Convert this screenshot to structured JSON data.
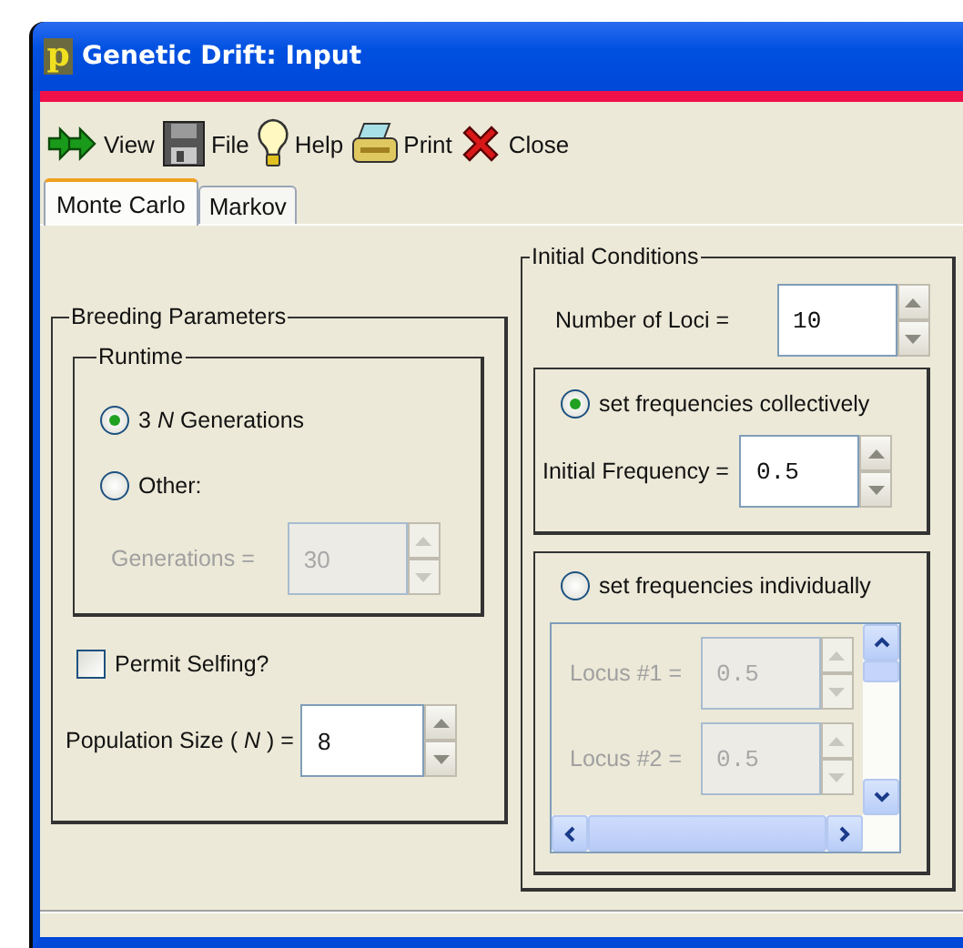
{
  "window": {
    "title": "Genetic Drift: Input",
    "icon_letter": "p"
  },
  "toolbar": [
    {
      "kind": "view",
      "label": "View"
    },
    {
      "kind": "file",
      "label": "File"
    },
    {
      "kind": "help",
      "label": "Help"
    },
    {
      "kind": "print",
      "label": "Print"
    },
    {
      "kind": "close",
      "label": "Close"
    }
  ],
  "tabs": [
    {
      "label": "Monte Carlo",
      "selected": true
    },
    {
      "label": "Markov",
      "selected": false
    }
  ],
  "breeding": {
    "title": "Breeding Parameters",
    "runtime": {
      "title": "Runtime",
      "options": [
        {
          "label": "3 *N* Generations",
          "selected": true
        },
        {
          "label": "Other:",
          "selected": false
        }
      ],
      "generations": {
        "label": "Generations =",
        "value": "30",
        "disabled": true
      }
    },
    "permit_selfing": {
      "label": "Permit Selfing?",
      "checked": false
    },
    "population": {
      "label": "Population Size ( *N* ) =",
      "value": "8",
      "disabled": false
    }
  },
  "initial": {
    "title": "Initial Conditions",
    "loci": {
      "label": "Number of Loci =",
      "value": "10",
      "disabled": false
    },
    "collective": {
      "label": "set frequencies collectively",
      "selected": true,
      "frequency": {
        "label": "Initial Frequency =",
        "value": "0.5",
        "disabled": false
      }
    },
    "individual": {
      "label": "set frequencies individually",
      "selected": false,
      "loci": [
        {
          "label": "Locus #1 =",
          "value": "0.5",
          "disabled": true
        },
        {
          "label": "Locus #2 =",
          "value": "0.5",
          "disabled": true
        }
      ]
    }
  }
}
